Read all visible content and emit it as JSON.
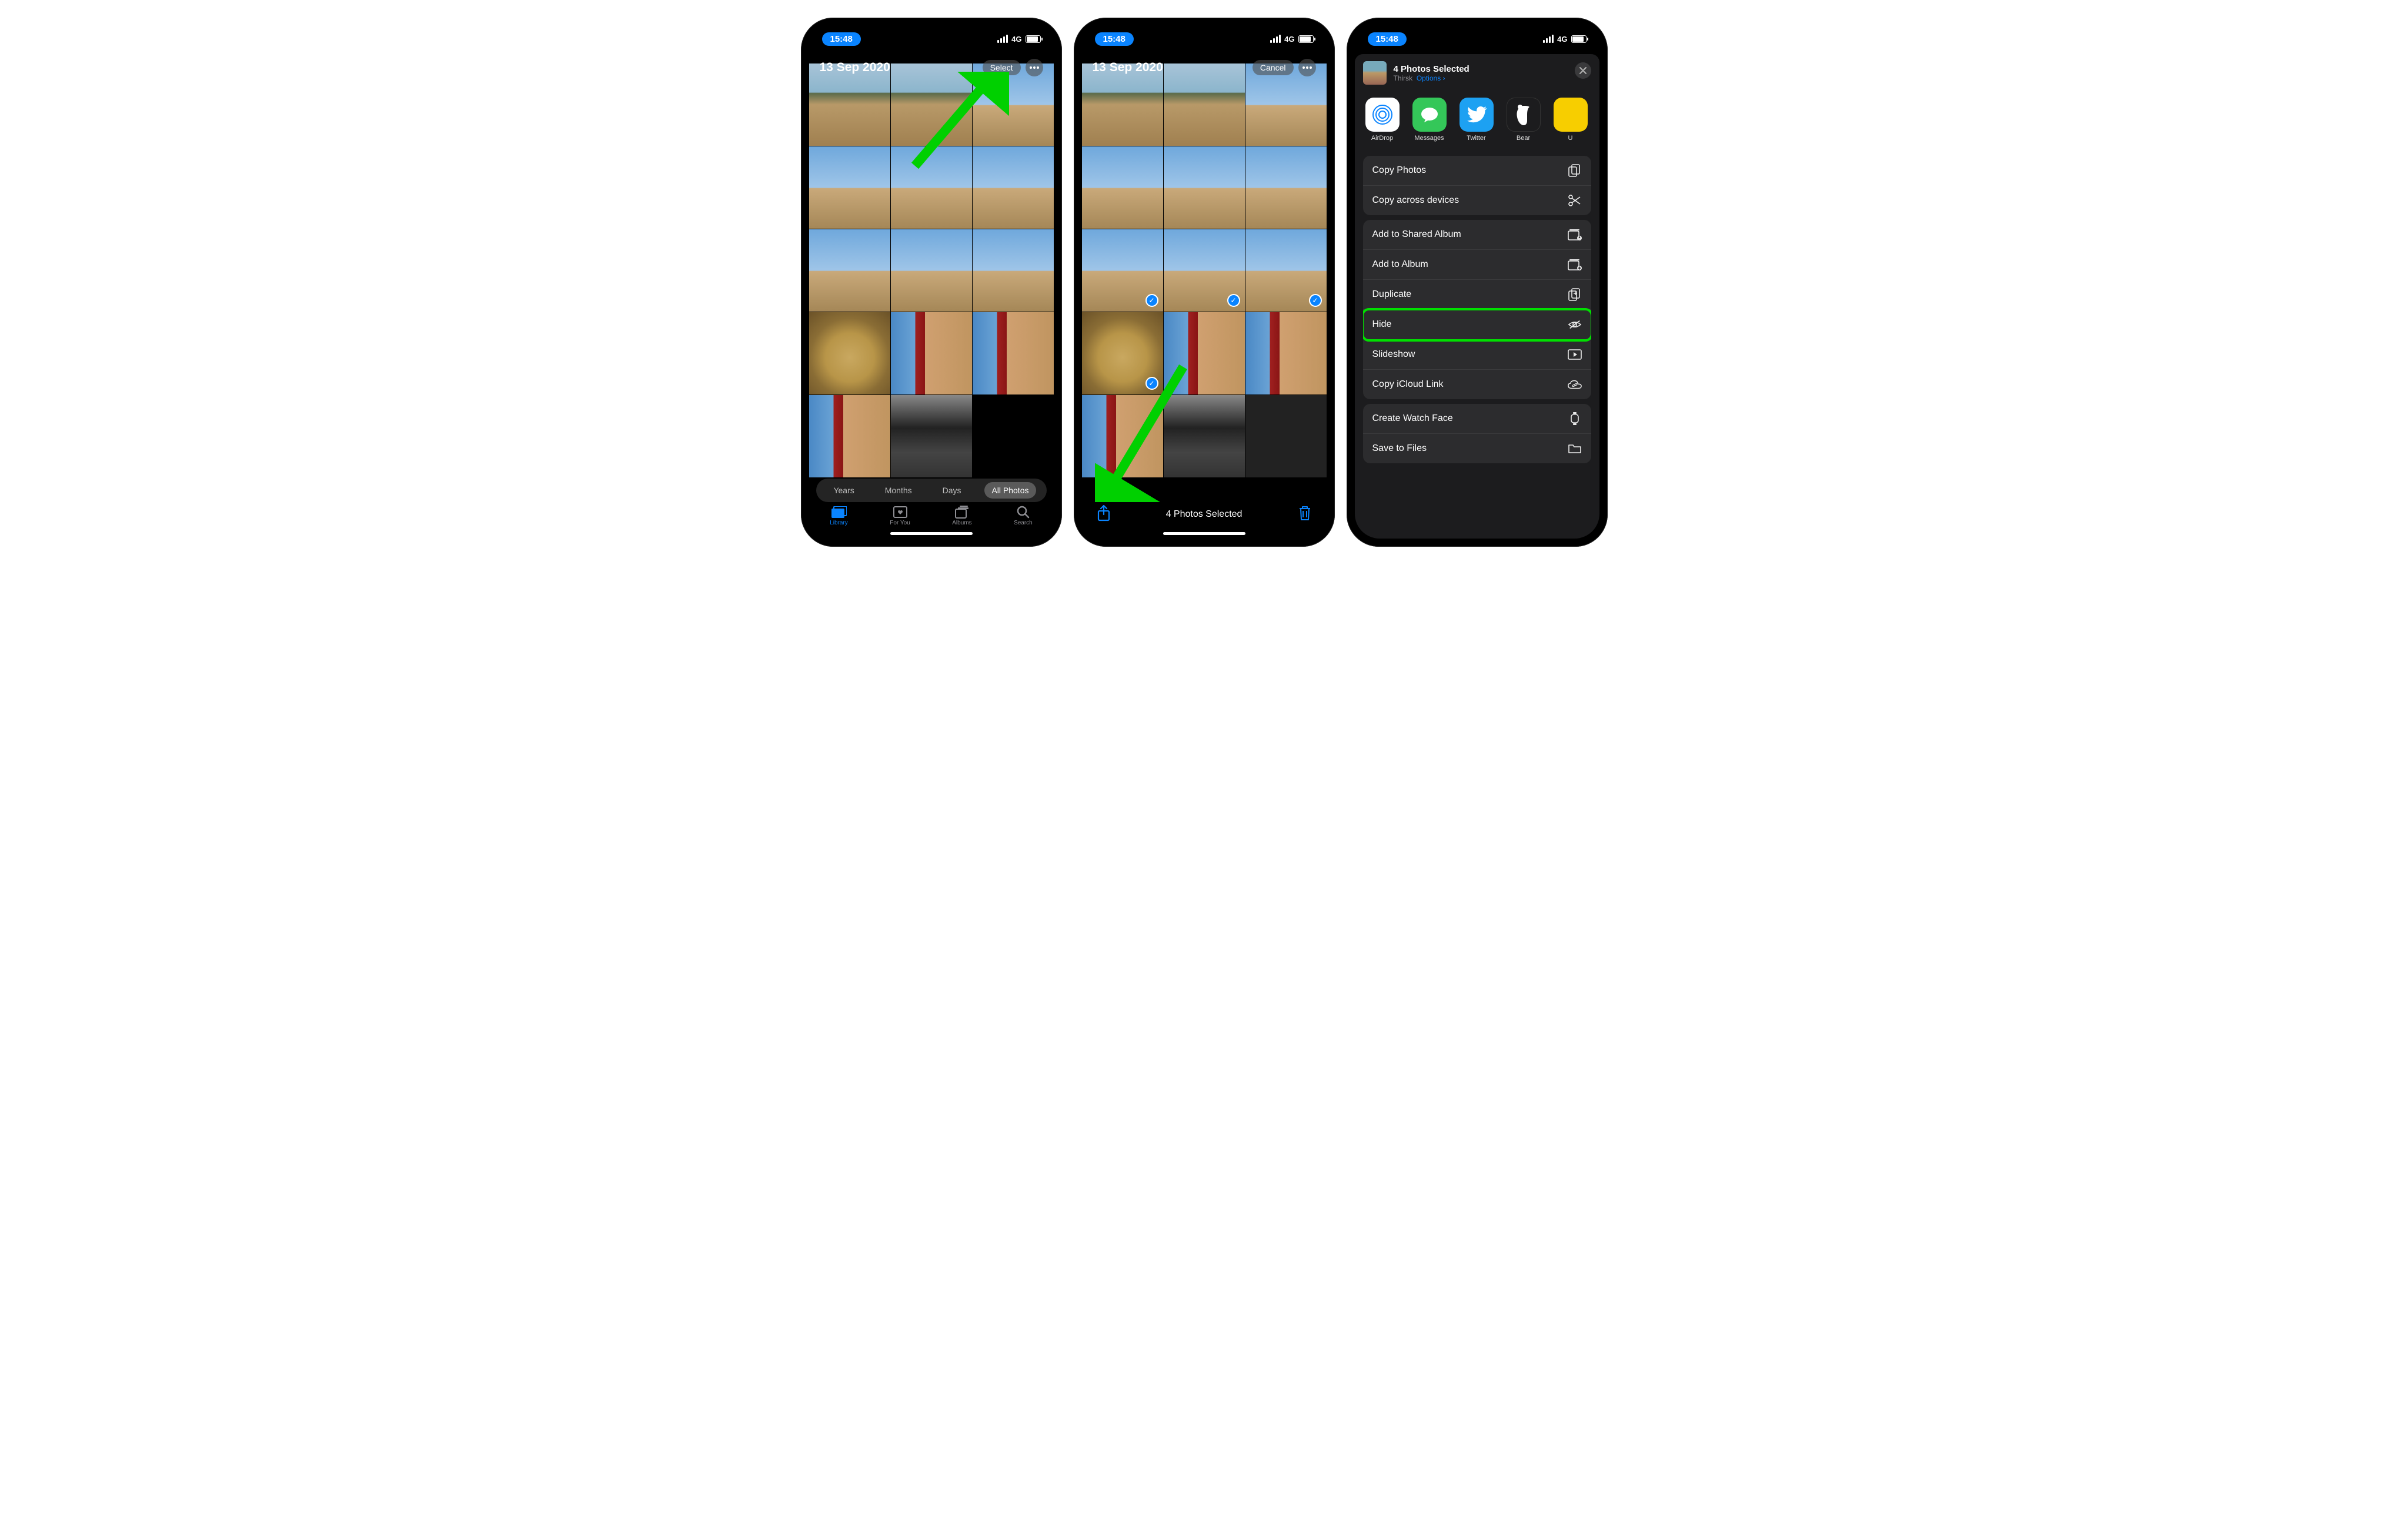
{
  "status": {
    "time": "15:48",
    "carrier": "4G"
  },
  "s1": {
    "date": "13 Sep 2020",
    "select": "Select",
    "tabs": {
      "years": "Years",
      "months": "Months",
      "days": "Days",
      "all": "All Photos"
    },
    "tabbar": {
      "library": "Library",
      "foryou": "For You",
      "albums": "Albums",
      "search": "Search"
    }
  },
  "s2": {
    "date": "13 Sep 2020",
    "cancel": "Cancel",
    "selectedLabel": "4 Photos Selected"
  },
  "s3": {
    "title": "4 Photos Selected",
    "location": "Thirsk",
    "options": "Options",
    "apps": {
      "airdrop": "AirDrop",
      "messages": "Messages",
      "twitter": "Twitter",
      "bear": "Bear",
      "u": "U"
    },
    "rows": {
      "copyPhotos": "Copy Photos",
      "copyAcross": "Copy across devices",
      "addShared": "Add to Shared Album",
      "addAlbum": "Add to Album",
      "duplicate": "Duplicate",
      "hide": "Hide",
      "slideshow": "Slideshow",
      "copyIcloud": "Copy iCloud Link",
      "createWatch": "Create Watch Face",
      "saveFiles": "Save to Files"
    }
  }
}
